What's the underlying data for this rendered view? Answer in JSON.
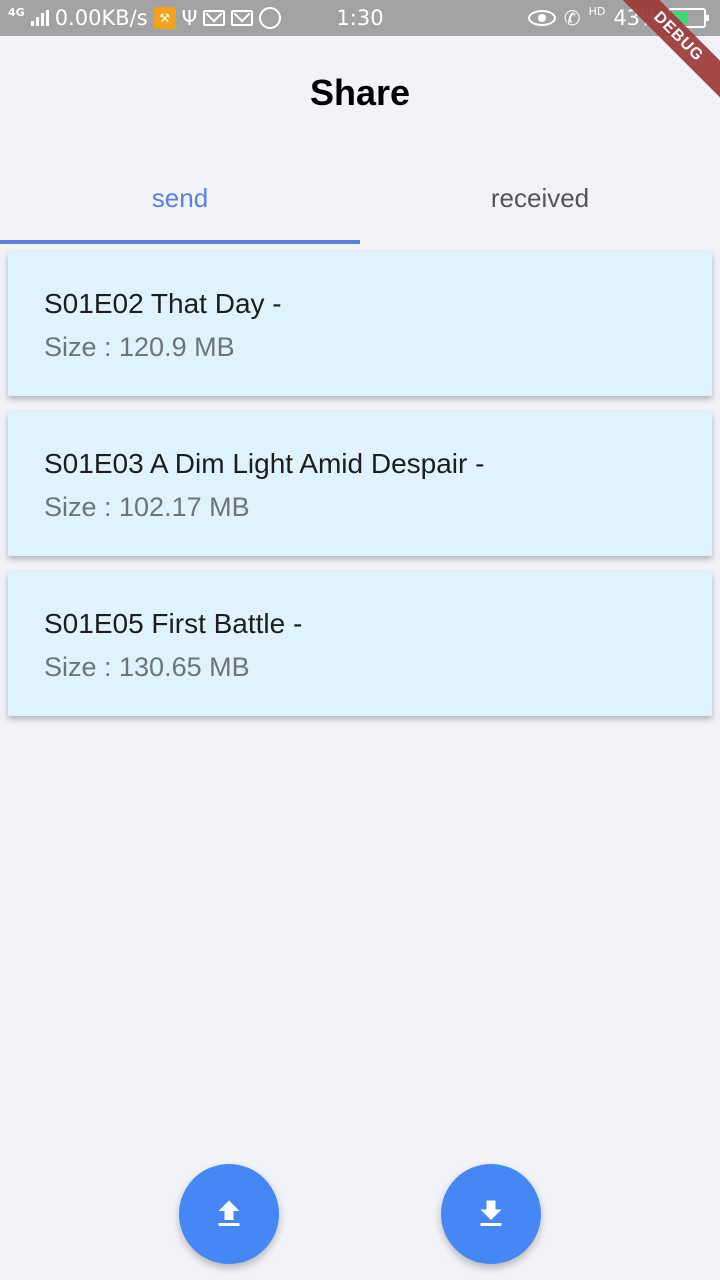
{
  "status_bar": {
    "network": "4G",
    "speed": "0.00KB/s",
    "time": "1:30",
    "hd": "HD",
    "battery": "43%",
    "battery_level": 0.43
  },
  "debug_ribbon": "DEBUG",
  "app_bar": {
    "title": "Share"
  },
  "tabs": [
    {
      "label": "send",
      "active": true
    },
    {
      "label": "received",
      "active": false
    }
  ],
  "files": [
    {
      "title": "S01E02 That Day -",
      "size": "Size : 120.9 MB"
    },
    {
      "title": "S01E03 A Dim Light Amid Despair -",
      "size": "Size : 102.17 MB"
    },
    {
      "title": "S01E05 First Battle -",
      "size": "Size : 130.65 MB"
    }
  ],
  "fabs": [
    {
      "icon": "upload-icon"
    },
    {
      "icon": "download-icon"
    }
  ],
  "colors": {
    "accent": "#5a7fe6",
    "fab": "#4487f5",
    "card_background": "#e0f3fd",
    "page_background": "#f2f3f8"
  }
}
